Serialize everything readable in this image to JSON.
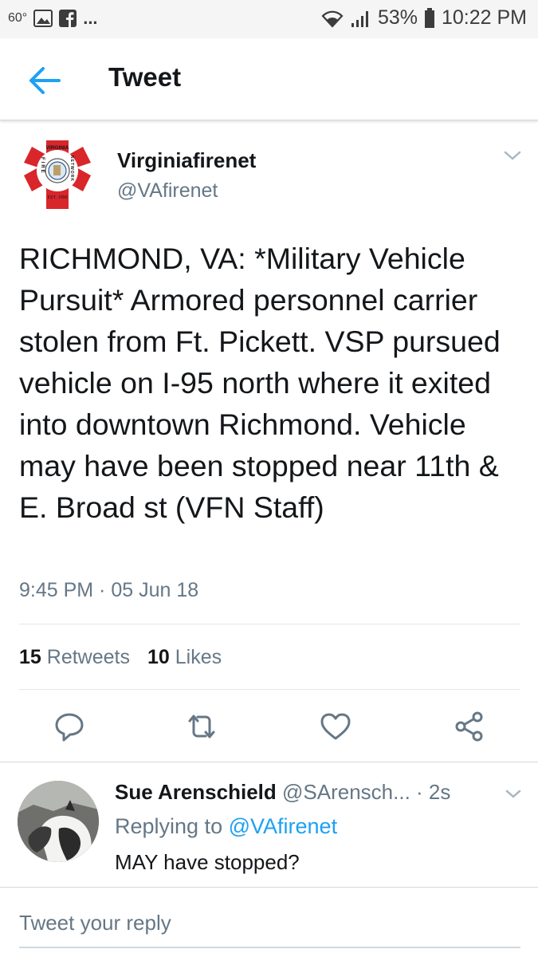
{
  "status_bar": {
    "temperature": "60°",
    "more": "...",
    "battery": "53%",
    "time": "10:22 PM"
  },
  "header": {
    "title": "Tweet",
    "back_icon": "arrow-left-icon"
  },
  "tweet": {
    "author_name": "Virginiafirenet",
    "author_handle": "@VAfirenet",
    "logo": {
      "top_text": "VIRGINIA",
      "left_text": "FIRE",
      "right_text": "NETWORK",
      "bottom_text": "EST. 1990"
    },
    "text": "RICHMOND, VA: *Military Vehicle Pursuit* Armored personnel carrier stolen from Ft. Pickett. VSP pursued vehicle on I-95 north where it exited into downtown Richmond. Vehicle may have been stopped near 11th & E. Broad st (VFN Staff)",
    "timestamp": "9:45 PM · 05 Jun 18",
    "retweets_count": "15",
    "retweets_label": "Retweets",
    "likes_count": "10",
    "likes_label": "Likes",
    "actions": [
      "reply-icon",
      "retweet-icon",
      "like-icon",
      "share-icon"
    ]
  },
  "reply": {
    "name": "Sue Arenschield",
    "handle": "@SArensch...",
    "time": "· 2s",
    "replying_prefix": "Replying to",
    "replying_to": "@VAfirenet",
    "text": "MAY have stopped?"
  },
  "compose": {
    "placeholder": "Tweet your reply"
  },
  "colors": {
    "accent": "#1da1f2",
    "secondary_text": "#657786",
    "logo_red": "#d9262b"
  }
}
